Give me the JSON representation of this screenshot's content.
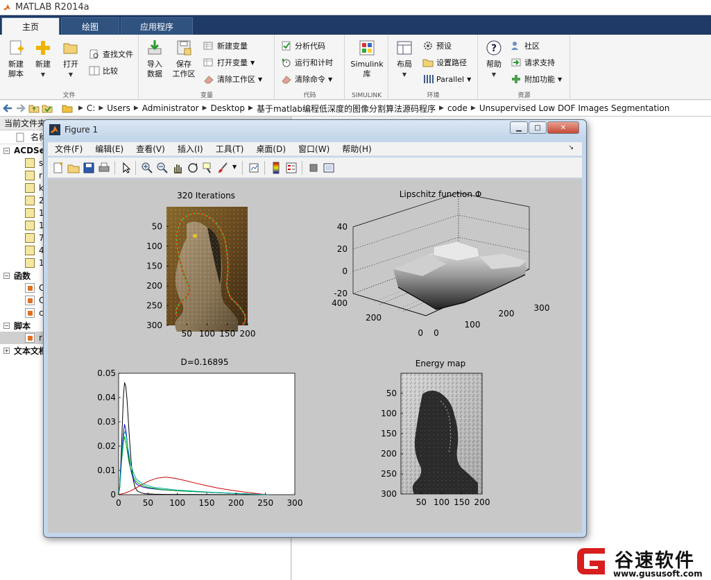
{
  "app": {
    "title": "MATLAB R2014a"
  },
  "tabs": [
    {
      "label": "主页"
    },
    {
      "label": "绘图"
    },
    {
      "label": "应用程序"
    }
  ],
  "ribbon": {
    "file": {
      "label": "文件",
      "new_script": "新建\n脚本",
      "new": "新建",
      "open": "打开",
      "find_files": "查找文件",
      "compare": "比较"
    },
    "variable": {
      "label": "变量",
      "import": "导入\n数据",
      "save_ws": "保存\n工作区",
      "new_var": "新建变量",
      "open_var": "打开变量",
      "clear_ws": "清除工作区"
    },
    "code": {
      "label": "代码",
      "analyze": "分析代码",
      "run_time": "运行和计时",
      "clear_cmd": "清除命令"
    },
    "simulink": {
      "label": "SIMULINK",
      "lib": "Simulink\n库"
    },
    "env": {
      "label": "环境",
      "layout": "布局",
      "prefs": "预设",
      "set_path": "设置路径",
      "parallel": "Parallel"
    },
    "resources": {
      "label": "资源",
      "help": "帮助",
      "community": "社区",
      "support": "请求支持",
      "addons": "附加功能"
    }
  },
  "address": {
    "parts": [
      "C:",
      "Users",
      "Administrator",
      "Desktop",
      "基于matlab编程低深度的图像分割算法源码程序",
      "code",
      "Unsupervised Low DOF Images Segmentation"
    ]
  },
  "left_panel": {
    "title": "当前文件夹",
    "col_name": "名称",
    "groups": [
      {
        "label": "ACDSee",
        "files": [
          "s",
          "r",
          "k",
          "2",
          "1",
          "1",
          "7",
          "4",
          "1"
        ]
      },
      {
        "label": "函数",
        "files": [
          "C",
          "C",
          "c"
        ]
      },
      {
        "label": "脚本",
        "files": [
          "r"
        ]
      },
      {
        "label": "文本文档",
        "files": []
      }
    ]
  },
  "figure": {
    "title": "Figure 1",
    "menu": [
      "文件(F)",
      "编辑(E)",
      "查看(V)",
      "插入(I)",
      "工具(T)",
      "桌面(D)",
      "窗口(W)",
      "帮助(H)"
    ]
  },
  "plots": {
    "p1": {
      "title": "320 Iterations",
      "yticks": [
        "50",
        "100",
        "150",
        "200",
        "250",
        "300"
      ],
      "xticks": [
        "50",
        "100",
        "150",
        "200"
      ]
    },
    "p2": {
      "title": "Lipschitz function Φ",
      "zticks": [
        "40",
        "20",
        "0",
        "-20"
      ],
      "yticks": [
        "400",
        "200",
        "0"
      ],
      "xticks": [
        "0",
        "100",
        "200",
        "300"
      ]
    },
    "p4": {
      "title": "Energy map",
      "yticks": [
        "50",
        "100",
        "150",
        "200",
        "250",
        "300"
      ],
      "xticks": [
        "50",
        "100",
        "150",
        "200"
      ]
    }
  },
  "chart_data": [
    {
      "type": "line",
      "title": "D=0.16895",
      "xlim": [
        0,
        300
      ],
      "ylim": [
        0,
        0.05
      ],
      "xticks": [
        "0",
        "50",
        "100",
        "150",
        "200",
        "250",
        "300"
      ],
      "yticks": [
        "0",
        "0.01",
        "0.02",
        "0.03",
        "0.04",
        "0.05"
      ],
      "series": [
        {
          "color": "#000000",
          "x": [
            0,
            2,
            5,
            8,
            10,
            12,
            14,
            16,
            18,
            20,
            22,
            25,
            28,
            32,
            38,
            45,
            60,
            80,
            255
          ],
          "y": [
            0,
            0.003,
            0.02,
            0.04,
            0.046,
            0.045,
            0.04,
            0.033,
            0.025,
            0.018,
            0.012,
            0.006,
            0.003,
            0.0015,
            0.0008,
            0.0004,
            0.0002,
            0.0001,
            0
          ]
        },
        {
          "color": "#0000cc",
          "x": [
            0,
            2,
            5,
            8,
            10,
            12,
            14,
            16,
            18,
            20,
            23,
            26,
            30,
            35,
            40,
            50,
            70,
            100,
            150,
            200,
            255
          ],
          "y": [
            0,
            0.004,
            0.016,
            0.025,
            0.029,
            0.027,
            0.023,
            0.018,
            0.014,
            0.011,
            0.008,
            0.006,
            0.0045,
            0.0037,
            0.0032,
            0.0027,
            0.0021,
            0.0016,
            0.001,
            0.0005,
            0
          ]
        },
        {
          "color": "#00aa00",
          "x": [
            0,
            2,
            5,
            8,
            10,
            12,
            14,
            16,
            18,
            20,
            23,
            26,
            30,
            35,
            40,
            50,
            70,
            100,
            150,
            200,
            255
          ],
          "y": [
            0,
            0.003,
            0.013,
            0.021,
            0.024,
            0.022,
            0.019,
            0.016,
            0.013,
            0.011,
            0.009,
            0.007,
            0.0055,
            0.0045,
            0.0038,
            0.003,
            0.0022,
            0.0016,
            0.001,
            0.0005,
            0
          ]
        },
        {
          "color": "#cc0000",
          "x": [
            0,
            10,
            20,
            35,
            50,
            65,
            80,
            95,
            110,
            130,
            150,
            170,
            190,
            210,
            230,
            245,
            255
          ],
          "y": [
            0,
            0.0006,
            0.0015,
            0.0035,
            0.0055,
            0.0068,
            0.0072,
            0.0068,
            0.006,
            0.0048,
            0.0037,
            0.0027,
            0.0019,
            0.0012,
            0.0006,
            0.0002,
            0
          ]
        },
        {
          "color": "#00aaaa",
          "x": [
            0,
            3,
            6,
            9,
            11,
            13,
            16,
            20,
            25,
            30,
            40,
            60,
            100,
            150,
            200,
            255
          ],
          "y": [
            0,
            0.006,
            0.018,
            0.025,
            0.026,
            0.024,
            0.019,
            0.013,
            0.009,
            0.0065,
            0.0045,
            0.003,
            0.0019,
            0.0011,
            0.0005,
            0
          ]
        }
      ]
    }
  ],
  "watermark": {
    "name": "谷速软件",
    "url": "www.gususoft.com"
  },
  "colors": {
    "ribbon_tabs_bg": "#1f3a66",
    "figure_frame": "#c4d6ea",
    "canvas_bg": "#c8c8c8",
    "watermark_red": "#d81e1e"
  }
}
